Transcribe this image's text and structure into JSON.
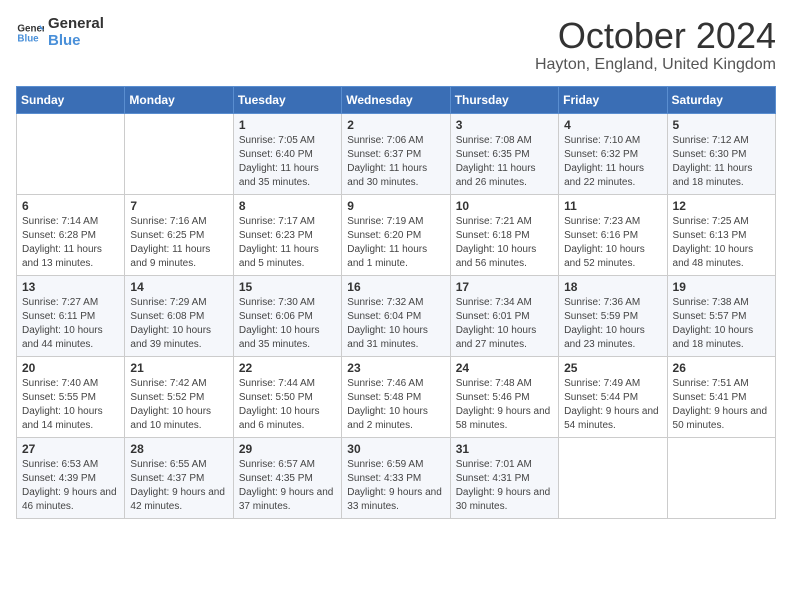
{
  "logo": {
    "line1": "General",
    "line2": "Blue"
  },
  "title": "October 2024",
  "location": "Hayton, England, United Kingdom",
  "days_header": [
    "Sunday",
    "Monday",
    "Tuesday",
    "Wednesday",
    "Thursday",
    "Friday",
    "Saturday"
  ],
  "weeks": [
    [
      {
        "day": "",
        "info": ""
      },
      {
        "day": "",
        "info": ""
      },
      {
        "day": "1",
        "info": "Sunrise: 7:05 AM\nSunset: 6:40 PM\nDaylight: 11 hours and 35 minutes."
      },
      {
        "day": "2",
        "info": "Sunrise: 7:06 AM\nSunset: 6:37 PM\nDaylight: 11 hours and 30 minutes."
      },
      {
        "day": "3",
        "info": "Sunrise: 7:08 AM\nSunset: 6:35 PM\nDaylight: 11 hours and 26 minutes."
      },
      {
        "day": "4",
        "info": "Sunrise: 7:10 AM\nSunset: 6:32 PM\nDaylight: 11 hours and 22 minutes."
      },
      {
        "day": "5",
        "info": "Sunrise: 7:12 AM\nSunset: 6:30 PM\nDaylight: 11 hours and 18 minutes."
      }
    ],
    [
      {
        "day": "6",
        "info": "Sunrise: 7:14 AM\nSunset: 6:28 PM\nDaylight: 11 hours and 13 minutes."
      },
      {
        "day": "7",
        "info": "Sunrise: 7:16 AM\nSunset: 6:25 PM\nDaylight: 11 hours and 9 minutes."
      },
      {
        "day": "8",
        "info": "Sunrise: 7:17 AM\nSunset: 6:23 PM\nDaylight: 11 hours and 5 minutes."
      },
      {
        "day": "9",
        "info": "Sunrise: 7:19 AM\nSunset: 6:20 PM\nDaylight: 11 hours and 1 minute."
      },
      {
        "day": "10",
        "info": "Sunrise: 7:21 AM\nSunset: 6:18 PM\nDaylight: 10 hours and 56 minutes."
      },
      {
        "day": "11",
        "info": "Sunrise: 7:23 AM\nSunset: 6:16 PM\nDaylight: 10 hours and 52 minutes."
      },
      {
        "day": "12",
        "info": "Sunrise: 7:25 AM\nSunset: 6:13 PM\nDaylight: 10 hours and 48 minutes."
      }
    ],
    [
      {
        "day": "13",
        "info": "Sunrise: 7:27 AM\nSunset: 6:11 PM\nDaylight: 10 hours and 44 minutes."
      },
      {
        "day": "14",
        "info": "Sunrise: 7:29 AM\nSunset: 6:08 PM\nDaylight: 10 hours and 39 minutes."
      },
      {
        "day": "15",
        "info": "Sunrise: 7:30 AM\nSunset: 6:06 PM\nDaylight: 10 hours and 35 minutes."
      },
      {
        "day": "16",
        "info": "Sunrise: 7:32 AM\nSunset: 6:04 PM\nDaylight: 10 hours and 31 minutes."
      },
      {
        "day": "17",
        "info": "Sunrise: 7:34 AM\nSunset: 6:01 PM\nDaylight: 10 hours and 27 minutes."
      },
      {
        "day": "18",
        "info": "Sunrise: 7:36 AM\nSunset: 5:59 PM\nDaylight: 10 hours and 23 minutes."
      },
      {
        "day": "19",
        "info": "Sunrise: 7:38 AM\nSunset: 5:57 PM\nDaylight: 10 hours and 18 minutes."
      }
    ],
    [
      {
        "day": "20",
        "info": "Sunrise: 7:40 AM\nSunset: 5:55 PM\nDaylight: 10 hours and 14 minutes."
      },
      {
        "day": "21",
        "info": "Sunrise: 7:42 AM\nSunset: 5:52 PM\nDaylight: 10 hours and 10 minutes."
      },
      {
        "day": "22",
        "info": "Sunrise: 7:44 AM\nSunset: 5:50 PM\nDaylight: 10 hours and 6 minutes."
      },
      {
        "day": "23",
        "info": "Sunrise: 7:46 AM\nSunset: 5:48 PM\nDaylight: 10 hours and 2 minutes."
      },
      {
        "day": "24",
        "info": "Sunrise: 7:48 AM\nSunset: 5:46 PM\nDaylight: 9 hours and 58 minutes."
      },
      {
        "day": "25",
        "info": "Sunrise: 7:49 AM\nSunset: 5:44 PM\nDaylight: 9 hours and 54 minutes."
      },
      {
        "day": "26",
        "info": "Sunrise: 7:51 AM\nSunset: 5:41 PM\nDaylight: 9 hours and 50 minutes."
      }
    ],
    [
      {
        "day": "27",
        "info": "Sunrise: 6:53 AM\nSunset: 4:39 PM\nDaylight: 9 hours and 46 minutes."
      },
      {
        "day": "28",
        "info": "Sunrise: 6:55 AM\nSunset: 4:37 PM\nDaylight: 9 hours and 42 minutes."
      },
      {
        "day": "29",
        "info": "Sunrise: 6:57 AM\nSunset: 4:35 PM\nDaylight: 9 hours and 37 minutes."
      },
      {
        "day": "30",
        "info": "Sunrise: 6:59 AM\nSunset: 4:33 PM\nDaylight: 9 hours and 33 minutes."
      },
      {
        "day": "31",
        "info": "Sunrise: 7:01 AM\nSunset: 4:31 PM\nDaylight: 9 hours and 30 minutes."
      },
      {
        "day": "",
        "info": ""
      },
      {
        "day": "",
        "info": ""
      }
    ]
  ]
}
